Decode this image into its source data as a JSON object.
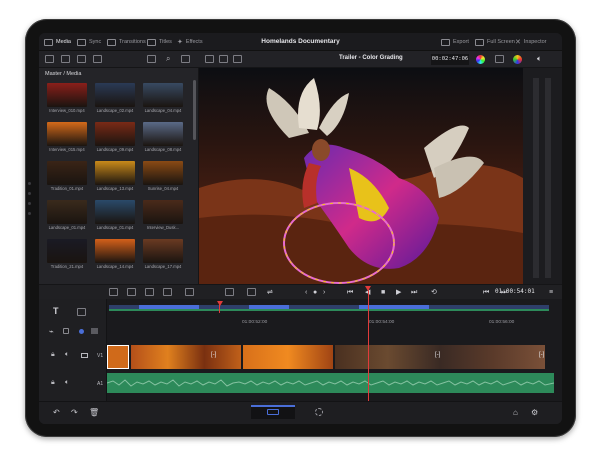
{
  "header": {
    "tabs": [
      {
        "label": "Media",
        "icon": "media-icon"
      },
      {
        "label": "Sync",
        "icon": "sync-icon"
      },
      {
        "label": "Transitions",
        "icon": "transitions-icon"
      },
      {
        "label": "Titles",
        "icon": "titles-icon"
      },
      {
        "label": "Effects",
        "icon": "effects-icon"
      }
    ],
    "project_title": "Homelands Documentary",
    "right_actions": [
      {
        "label": "Export",
        "icon": "export-icon"
      },
      {
        "label": "Full Screen",
        "icon": "fullscreen-icon"
      },
      {
        "label": "Inspector",
        "icon": "inspector-icon"
      }
    ]
  },
  "viewer": {
    "clip_title": "Trailer - Color Grading",
    "timecode": "00:02:47:06"
  },
  "media_pool": {
    "breadcrumb": "Master / Media",
    "clips": [
      {
        "name": "Interview_010.mp4",
        "color": "#8a1f1a"
      },
      {
        "name": "Landscape_02.mp4",
        "color": "#2a3a55"
      },
      {
        "name": "Landscape_04.mp4",
        "color": "#384a62"
      },
      {
        "name": "Interview_015.mp4",
        "color": "#d46a1a"
      },
      {
        "name": "Landscape_09.mp4",
        "color": "#7a2a16"
      },
      {
        "name": "Landscape_08.mp4",
        "color": "#5a6a88"
      },
      {
        "name": "Tradition_01.mp4",
        "color": "#3a2416"
      },
      {
        "name": "Landscape_13.mp4",
        "color": "#c98a1a"
      },
      {
        "name": "Sunrise_04.mp4",
        "color": "#8a4a14"
      },
      {
        "name": "Landscape_01.mp4",
        "color": "#3a2a1c"
      },
      {
        "name": "Landscape_01.mp4",
        "color": "#2a4a6a"
      },
      {
        "name": "Interview_Dusk...",
        "color": "#4a2a1a"
      },
      {
        "name": "Tradition_21.mp4",
        "color": "#1a1a24"
      },
      {
        "name": "Landscape_14.mp4",
        "color": "#d4601a"
      },
      {
        "name": "Landscape_17.mp4",
        "color": "#6a3a22"
      }
    ]
  },
  "transport": {
    "timecode": "01:00:54:01"
  },
  "timeline": {
    "ruler_labels": [
      "01:00:52:00",
      "01:00:54:00",
      "01:00:56:00"
    ],
    "tracks": [
      {
        "name": "V1",
        "type": "video"
      },
      {
        "name": "A1",
        "type": "audio"
      }
    ],
    "transition_marker": "[-]"
  },
  "colors": {
    "playhead": "#e13b3b",
    "audio_track": "#2d8a5a",
    "accent": "#4a6ed8"
  }
}
